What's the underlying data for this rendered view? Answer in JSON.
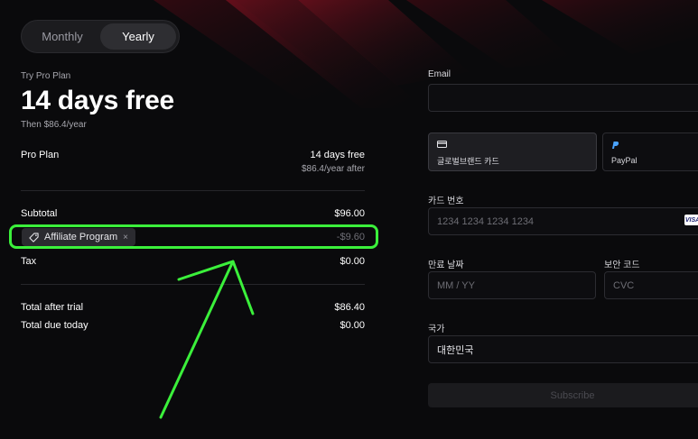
{
  "billing_toggle": {
    "monthly": "Monthly",
    "yearly": "Yearly",
    "selected": "Yearly"
  },
  "plan": {
    "eyebrow": "Try Pro Plan",
    "headline": "14 days free",
    "then_price": "Then $86.4/year"
  },
  "summary": {
    "item_name": "Pro Plan",
    "item_trial": "14 days free",
    "item_after": "$86.4/year after",
    "subtotal_label": "Subtotal",
    "subtotal_value": "$96.00",
    "coupon_label": "Affiliate Program",
    "coupon_remove": "×",
    "discount_value": "-$9.60",
    "tax_label": "Tax",
    "tax_value": "$0.00",
    "total_after_trial_label": "Total after trial",
    "total_after_trial_value": "$86.40",
    "total_due_today_label": "Total due today",
    "total_due_today_value": "$0.00"
  },
  "form": {
    "email_label": "Email",
    "email_value": "",
    "payment_methods": [
      {
        "label": "글로벌브랜드 카드",
        "icon": "card-icon",
        "selected": true
      },
      {
        "label": "PayPal",
        "icon": "paypal-icon",
        "selected": false
      }
    ],
    "card_number_label": "카드 번호",
    "card_number_placeholder": "1234 1234 1234 1234",
    "card_brand": "VISA",
    "expiry_label": "만료 날짜",
    "expiry_placeholder": "MM / YY",
    "cvc_label": "보안 코드",
    "cvc_placeholder": "CVC",
    "country_label": "국가",
    "country_value": "대한민국",
    "subscribe_label": "Subscribe"
  },
  "colors": {
    "background": "#0a0a0c",
    "highlight": "#3bf03b",
    "accent_red": "#7a1020"
  }
}
